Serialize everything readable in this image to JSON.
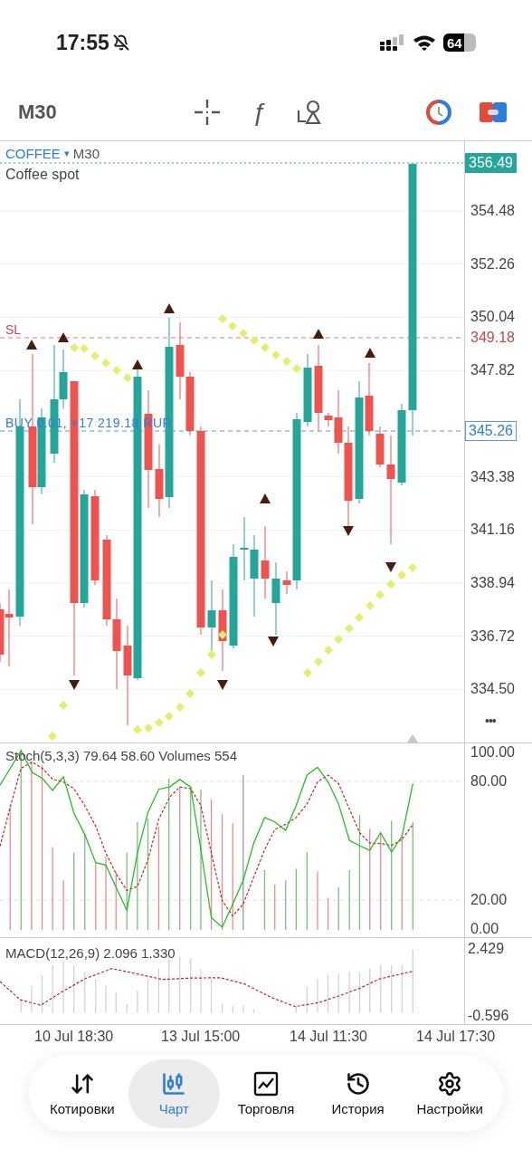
{
  "status_bar": {
    "time": "17:55",
    "battery": "64"
  },
  "toolbar": {
    "timeframe": "M30",
    "function_glyph": "ƒ"
  },
  "chart": {
    "symbol": "COFFEE",
    "dropdown_glyph": "▾",
    "timeframe": "M30",
    "description": "Coffee spot",
    "price_labels": [
      "354.48",
      "352.26",
      "350.04",
      "347.82",
      "343.38",
      "341.16",
      "338.94",
      "336.72",
      "334.50"
    ],
    "current_price": "356.49",
    "stop_loss": {
      "label": "SL",
      "price": "349.18"
    },
    "position": {
      "label": "BUY 0.01, +17 219.18 RUR",
      "price": "345.26"
    },
    "more_glyph": "•••"
  },
  "stochastic": {
    "legend": "Stoch(5,3,3) 79.64 58.60 Volumes 554",
    "axis_labels": [
      "100.00",
      "80.00",
      "20.00",
      "0.00"
    ]
  },
  "macd": {
    "legend": "MACD(12,26,9) 2.096 1.330",
    "axis_labels": [
      "2.429",
      "-0.596"
    ]
  },
  "time_labels": [
    "10 Jul 18:30",
    "13 Jul 15:00",
    "14 Jul 11:30",
    "14 Jul 17:30"
  ],
  "nav": [
    {
      "label": "Котировки",
      "selected": false
    },
    {
      "label": "Чарт",
      "selected": true
    },
    {
      "label": "Торговля",
      "selected": false
    },
    {
      "label": "История",
      "selected": false
    },
    {
      "label": "Настройки",
      "selected": false
    }
  ]
}
